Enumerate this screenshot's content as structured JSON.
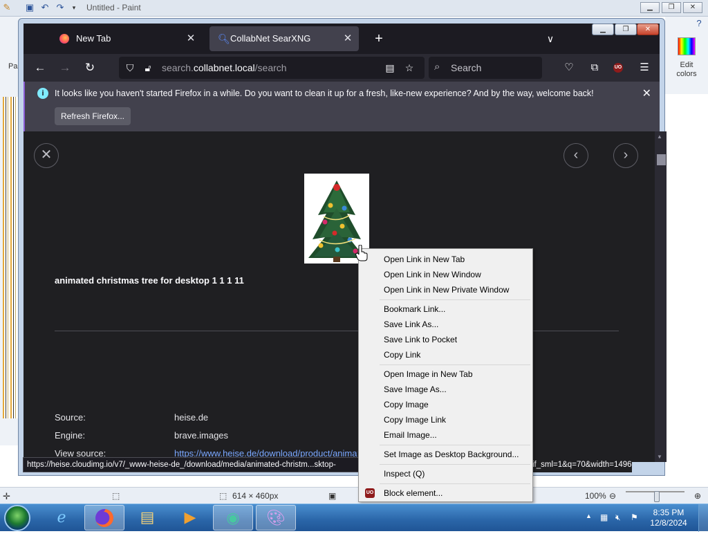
{
  "paint": {
    "title": "Untitled - Paint",
    "left_label": "Pa",
    "edit_colors": "Edit colors",
    "status": {
      "dimensions": "614 × 460px",
      "zoom": "100%"
    }
  },
  "browser": {
    "tabs": [
      {
        "label": "New Tab"
      },
      {
        "label": "CollabNet SearXNG"
      }
    ],
    "url": {
      "prefix": "search.",
      "host": "collabnet.local",
      "path": "/search"
    },
    "search_placeholder": "Search",
    "notification": {
      "text": "It looks like you haven't started Firefox in a while. Do you want to clean it up for a fresh, like-new experience? And by the way, welcome back!",
      "button": "Refresh Firefox..."
    },
    "status_url": "https://heise.cloudimg.io/v7/_www-heise-de_/download/media/animated-christm...sktop-",
    "status_url_tail": "if_sml=1&q=70&width=1496"
  },
  "result": {
    "title": "animated christmas tree for desktop 1 1 1 11",
    "meta": [
      {
        "label": "Source:",
        "value": "heise.de"
      },
      {
        "label": "Engine:",
        "value": "brave.images"
      },
      {
        "label": "View source:",
        "value": "https://www.heise.de/download/product/animat"
      }
    ]
  },
  "context_menu": {
    "groups": [
      [
        "Open Link in New Tab",
        "Open Link in New Window",
        "Open Link in New Private Window"
      ],
      [
        "Bookmark Link...",
        "Save Link As...",
        "Save Link to Pocket",
        "Copy Link"
      ],
      [
        "Open Image in New Tab",
        "Save Image As...",
        "Copy Image",
        "Copy Image Link",
        "Email Image..."
      ],
      [
        "Set Image as Desktop Background..."
      ],
      [
        "Inspect (Q)"
      ],
      [
        "Block element..."
      ]
    ],
    "ublock_badge": "UO"
  },
  "taskbar": {
    "time": "8:35 PM",
    "date": "12/8/2024"
  },
  "colors": {
    "firefox_dark": "#1c1b22",
    "toolbar": "#2b2a33",
    "active_tab": "#42414d",
    "link": "#7aa7ff",
    "notification_accent": "#8a5cd6"
  }
}
